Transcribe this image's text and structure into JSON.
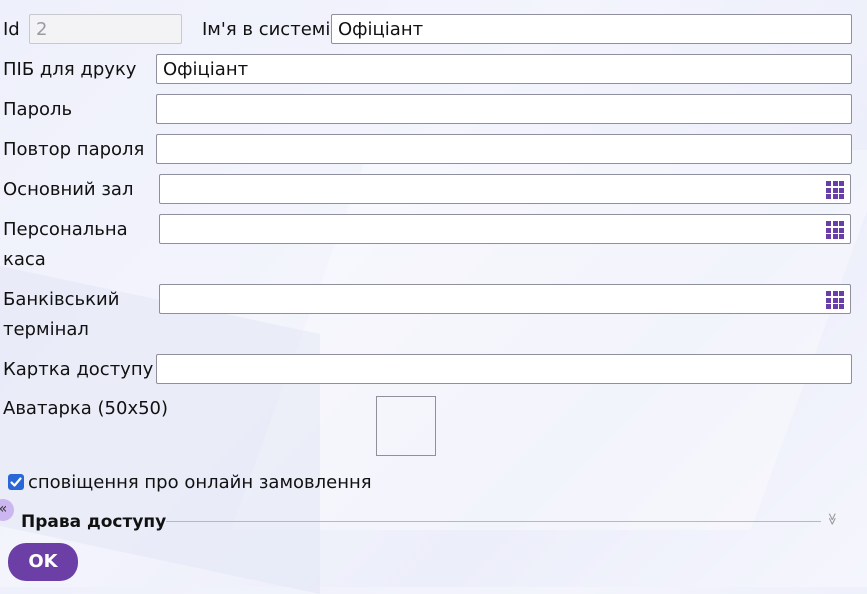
{
  "form": {
    "id_label": "Id",
    "id_value": "2",
    "login_label": "Ім'я в системі",
    "login_value": "Офіціант",
    "print_name_label": "ПІБ для друку",
    "print_name_value": "Офіціант",
    "password_label": "Пароль",
    "password_value": "",
    "password_repeat_label": "Повтор пароля",
    "password_repeat_value": "",
    "main_hall_label": "Основний зал",
    "main_hall_value": "",
    "personal_cash_label": "Персональна каса",
    "personal_cash_value": "",
    "bank_terminal_label": "Банківський термінал",
    "bank_terminal_value": "",
    "access_card_label": "Картка доступу",
    "access_card_value": "",
    "avatar_label": "Аватарка (50x50)",
    "online_orders_notify_label": "сповіщення про онлайн замовлення",
    "online_orders_notify_checked": true
  },
  "sections": {
    "access_rights_label": "Права доступу",
    "collapse_glyph": "«",
    "expand_glyph": "≫"
  },
  "actions": {
    "ok_label": "OK"
  },
  "icons": {
    "picker_icon": "grid-dots-icon",
    "picker_color": "#6a3ea8"
  },
  "colors": {
    "accent": "#6b3fa6",
    "checkbox": "#2a67d6"
  }
}
